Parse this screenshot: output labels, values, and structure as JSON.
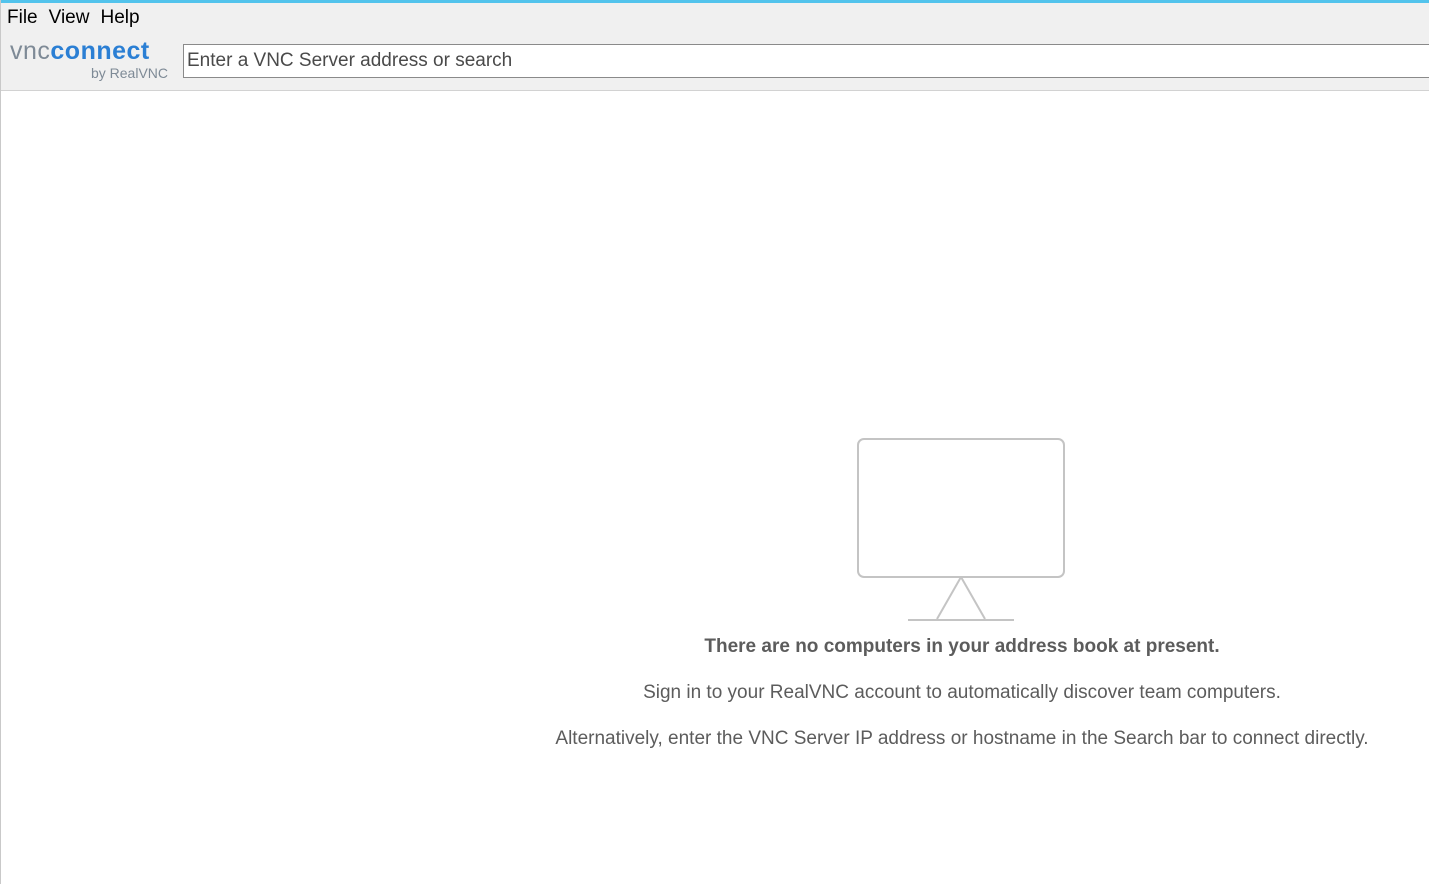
{
  "menu": {
    "file": "File",
    "view": "View",
    "help": "Help"
  },
  "logo": {
    "vnc": "vnc",
    "connect": "connect",
    "by": "by RealVNC"
  },
  "search": {
    "placeholder": "Enter a VNC Server address or search"
  },
  "empty_state": {
    "title": "There are no computers in your address book at present.",
    "line1": "Sign in to your RealVNC account to automatically discover team computers.",
    "line2": "Alternatively, enter the VNC Server IP address or hostname in the Search bar to connect directly."
  },
  "colors": {
    "accent_top": "#52c3ec",
    "logo_blue": "#2b7fd4",
    "logo_gray": "#7e8a96",
    "text_gray": "#5c5c5c"
  },
  "icons": {
    "empty": "monitor-icon"
  }
}
